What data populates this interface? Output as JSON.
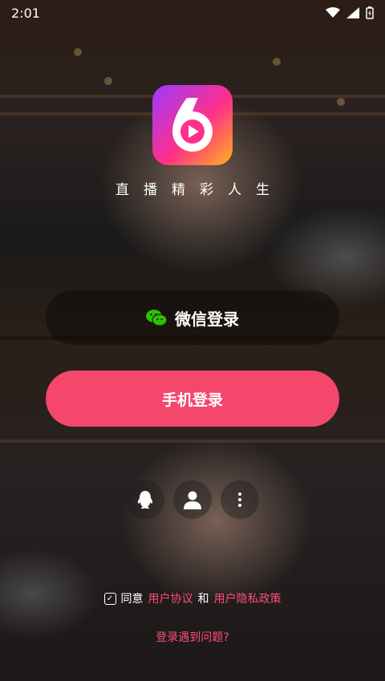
{
  "status_bar": {
    "time": "2:01"
  },
  "app": {
    "tagline": "直播精彩人生"
  },
  "login": {
    "wechat_label": "微信登录",
    "phone_label": "手机登录"
  },
  "agreement": {
    "prefix": "同意",
    "user_agreement": "用户协议",
    "and": "和",
    "privacy_policy": "用户隐私政策"
  },
  "help_link": "登录遇到问题?",
  "icons": {
    "qq": "qq-icon",
    "account": "person-icon",
    "more": "more-vertical-icon"
  },
  "colors": {
    "accent": "#f4476b",
    "link": "#ff4d79",
    "wechat_green": "#2dc100"
  }
}
